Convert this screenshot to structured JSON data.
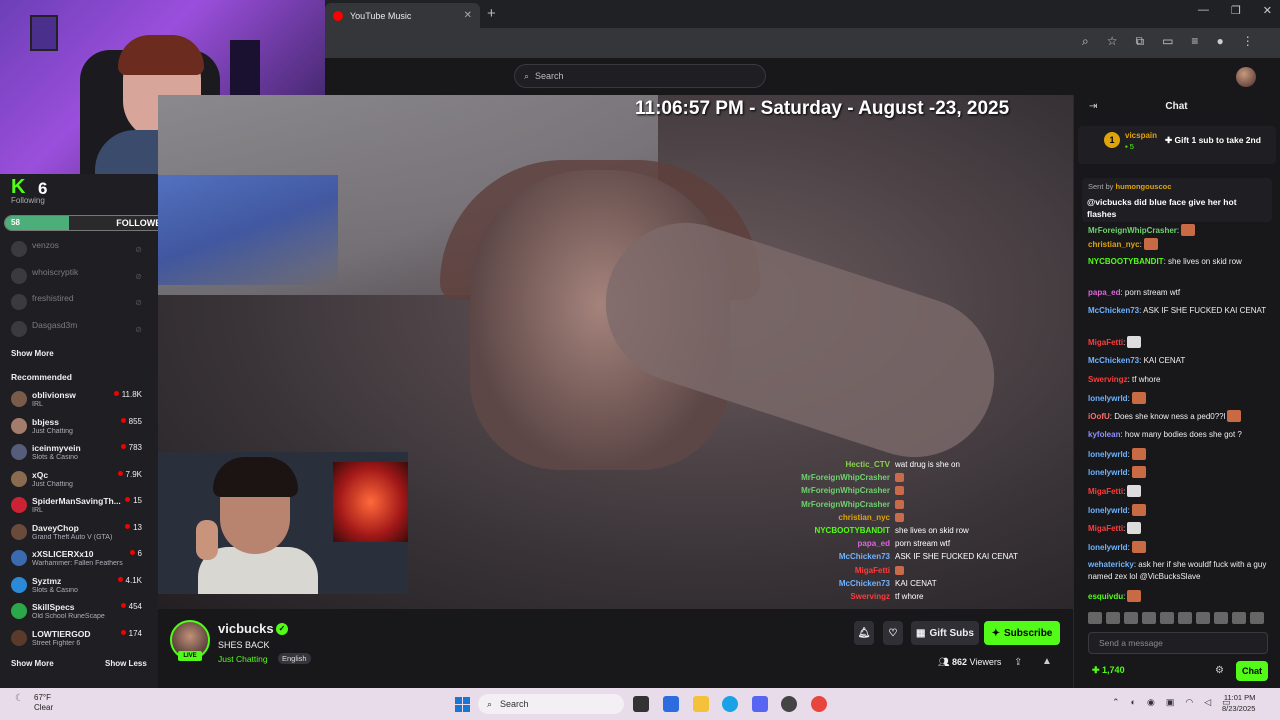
{
  "browser": {
    "tab_title": "YouTube Music",
    "tab_close": "✕",
    "new_tab": "+",
    "window_controls": [
      "—",
      "❐",
      "✕"
    ],
    "toolbar_icons": [
      "zoom-icon",
      "star-icon",
      "extensions-icon",
      "cast-icon",
      "media-icon",
      "profile-icon",
      "menu-icon"
    ]
  },
  "topnav": {
    "search_placeholder": "Search"
  },
  "kick_overlay": {
    "followers_count": "6",
    "following_label": "Following",
    "goal_start": "58",
    "goal_label": "FOLLOWERS",
    "goal_end": "250",
    "goal_progress": 0.23
  },
  "sidebar": {
    "offline": [
      {
        "name": "venzos"
      },
      {
        "name": "whoiscryptik"
      },
      {
        "name": "freshistired"
      },
      {
        "name": "Dasgasd3m"
      }
    ],
    "show_more_top": "Show More",
    "recommended_heading": "Recommended",
    "recommended": [
      {
        "name": "oblivionsw",
        "category": "IRL",
        "viewers": "11.8K"
      },
      {
        "name": "bbjess",
        "category": "Just Chatting",
        "viewers": "855"
      },
      {
        "name": "iceinmyvein",
        "category": "Slots & Casino",
        "viewers": "783"
      },
      {
        "name": "xQc",
        "category": "Just Chatting",
        "viewers": "7.9K"
      },
      {
        "name": "SpiderManSavingTh...",
        "category": "IRL",
        "viewers": "15"
      },
      {
        "name": "DaveyChop",
        "category": "Grand Theft Auto V (GTA)",
        "viewers": "13"
      },
      {
        "name": "xXSLICERXx10",
        "category": "Warhammer: Fallen Feathers",
        "viewers": "6"
      },
      {
        "name": "Syztmz",
        "category": "Slots & Casino",
        "viewers": "4.1K"
      },
      {
        "name": "SkillSpecs",
        "category": "Old School RuneScape",
        "viewers": "454"
      },
      {
        "name": "LOWTIERGOD",
        "category": "Street Fighter 6",
        "viewers": "174"
      }
    ],
    "show_more": "Show More",
    "show_less": "Show Less"
  },
  "video": {
    "timestamp": "11:06:57 PM - Saturday - August -23, 2025",
    "overlay_chat": [
      {
        "user": "Hectic_CTV",
        "color": "#8bd14b",
        "msg": "wat drug is she on"
      },
      {
        "user": "MrForeignWhipCrasher",
        "color": "#6fd26f",
        "msg": "",
        "emote": true
      },
      {
        "user": "MrForeignWhipCrasher",
        "color": "#6fd26f",
        "msg": "",
        "emote": true
      },
      {
        "user": "MrForeignWhipCrasher",
        "color": "#6fd26f",
        "msg": "",
        "emote": true
      },
      {
        "user": "christian_nyc",
        "color": "#e0a40b",
        "msg": "",
        "emote": true
      },
      {
        "user": "NYCBOOTYBANDIT",
        "color": "#53fc18",
        "msg": "she lives on skid row"
      },
      {
        "user": "papa_ed",
        "color": "#d66ad6",
        "msg": "porn stream wtf"
      },
      {
        "user": "McChicken73",
        "color": "#6fb3ff",
        "msg": "ASK IF SHE FUCKED KAI CENAT"
      },
      {
        "user": "MigaFetti",
        "color": "#ff3b3b",
        "msg": "",
        "emote": true
      },
      {
        "user": "McChicken73",
        "color": "#6fb3ff",
        "msg": "KAI CENAT"
      },
      {
        "user": "Swervingz",
        "color": "#ff3b3b",
        "msg": "tf whore"
      }
    ]
  },
  "stream_info": {
    "live_tag": "LIVE",
    "channel": "vicbucks",
    "verified": "✓",
    "title": "SHES BACK",
    "category": "Just Chatting",
    "language": "English",
    "gift_subs": "Gift Subs",
    "subscribe": "Subscribe",
    "viewers_count": "862",
    "viewers_label": "Viewers"
  },
  "chat": {
    "title": "Chat",
    "pinned_user": "vicspain",
    "pinned_subs": "5",
    "pinned_goal": "Gift 1 sub to take 2nd",
    "reply_sent_by_label": "Sent by",
    "reply_sent_by_user": "humongouscoc",
    "reply_message": "@vicbucks did blue face give her hot flashes",
    "messages": [
      {
        "user": "MrForeignWhipCrasher",
        "color": "#6fd26f",
        "msg": ":",
        "emote": "e"
      },
      {
        "user": "christian_nyc",
        "color": "#e0a40b",
        "msg": ":",
        "emote": "e"
      },
      {
        "user": "NYCBOOTYBANDIT",
        "color": "#53fc18",
        "msg": ": she lives on skid row"
      },
      {
        "user": "papa_ed",
        "color": "#d66ad6",
        "msg": ": porn stream wtf"
      },
      {
        "user": "McChicken73",
        "color": "#6fb3ff",
        "msg": ": ASK IF SHE FUCKED KAI CENAT"
      },
      {
        "user": "MigaFetti",
        "color": "#ff3b3b",
        "msg": ":",
        "emote": "w"
      },
      {
        "user": "McChicken73",
        "color": "#6fb3ff",
        "msg": ": KAI CENAT"
      },
      {
        "user": "Swervingz",
        "color": "#ff3b3b",
        "msg": ": tf whore"
      },
      {
        "user": "lonelywrld",
        "color": "#6fb3ff",
        "msg": ":",
        "emote": "e"
      },
      {
        "user": "iOofU",
        "color": "#ff6a6a",
        "msg": ": Does she know ness a ped0??l",
        "emote": "e"
      },
      {
        "user": "kyfolean",
        "color": "#8f8fff",
        "msg": ": how many bodies does she got ?"
      },
      {
        "user": "lonelywrld",
        "color": "#6fb3ff",
        "msg": ":",
        "emote": "e"
      },
      {
        "user": "lonelywrld",
        "color": "#6fb3ff",
        "msg": ":",
        "emote": "e"
      },
      {
        "user": "MigaFetti",
        "color": "#ff3b3b",
        "msg": ":",
        "emote": "w"
      },
      {
        "user": "lonelywrld",
        "color": "#6fb3ff",
        "msg": ":",
        "emote": "e"
      },
      {
        "user": "MigaFetti",
        "color": "#ff3b3b",
        "msg": ":",
        "emote": "w"
      },
      {
        "user": "lonelywrld",
        "color": "#6fb3ff",
        "msg": ":",
        "emote": "e"
      },
      {
        "user": "wehatericky",
        "color": "#6fb3ff",
        "msg": ": ask her if she wouldf fuck with a guy named zex lol @VicBucksSlave"
      },
      {
        "user": "esquivdu",
        "color": "#53fc18",
        "msg": ":",
        "emote": "e"
      }
    ],
    "input_placeholder": "Send a message",
    "points": "1,740",
    "chat_button": "Chat"
  },
  "taskbar": {
    "temperature": "67°F",
    "weather": "Clear",
    "search": "Search",
    "time": "11:01 PM",
    "date": "8/23/2025"
  }
}
